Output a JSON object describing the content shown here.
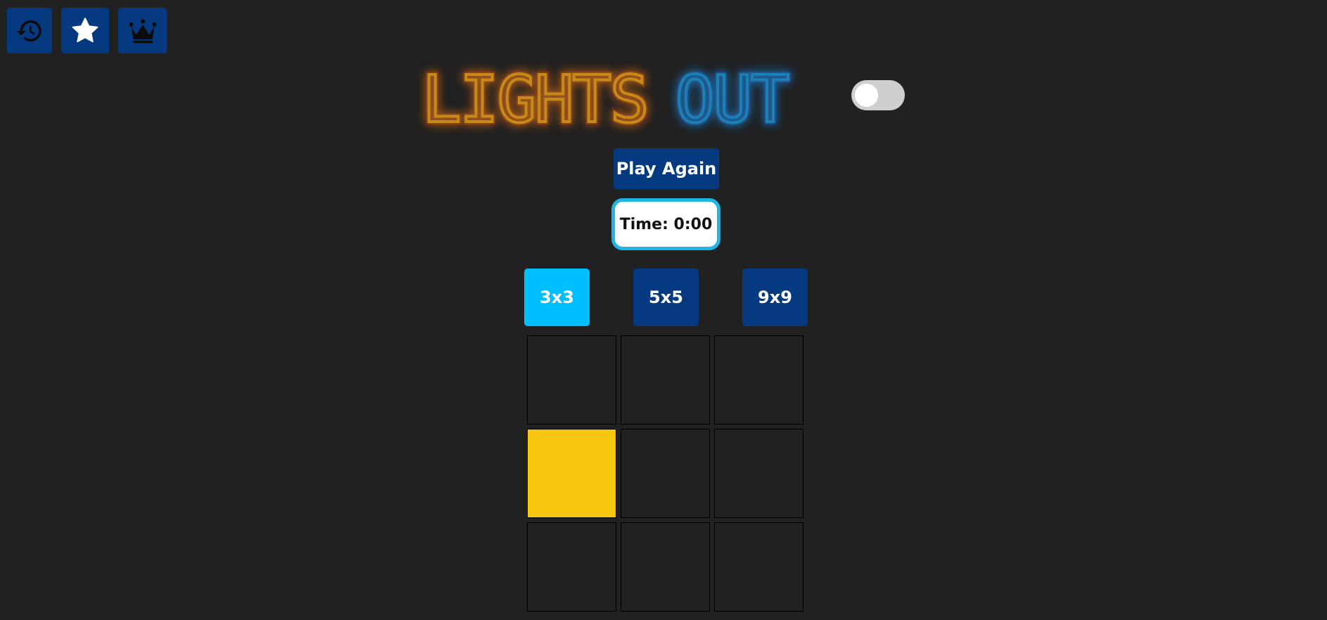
{
  "toolbar": {
    "buttons": [
      {
        "name": "history",
        "icon": "history-icon"
      },
      {
        "name": "favorites",
        "icon": "star-icon"
      },
      {
        "name": "leaderboard",
        "icon": "crown-icon"
      }
    ],
    "button_color": "#063a80"
  },
  "title": {
    "word1": "LIGHTS",
    "word2": "OUT",
    "word1_color": "#c88a12",
    "word1_glow": "#d0331a",
    "word2_color": "#1b7fb5",
    "word2_glow": "#1a66d6"
  },
  "theme_toggle": {
    "on": false
  },
  "controls": {
    "play_again_label": "Play Again",
    "timer_text": "Time: 0:00"
  },
  "sizes": {
    "options": [
      "3x3",
      "5x5",
      "9x9"
    ],
    "selected_index": 0,
    "selected_color": "#00bfff",
    "default_color": "#063a80"
  },
  "board": {
    "rows": 3,
    "cols": 3,
    "lit": [
      [
        false,
        false,
        false
      ],
      [
        true,
        false,
        false
      ],
      [
        false,
        false,
        false
      ]
    ],
    "on_color": "#f5c50f",
    "off_color": "#212121"
  }
}
